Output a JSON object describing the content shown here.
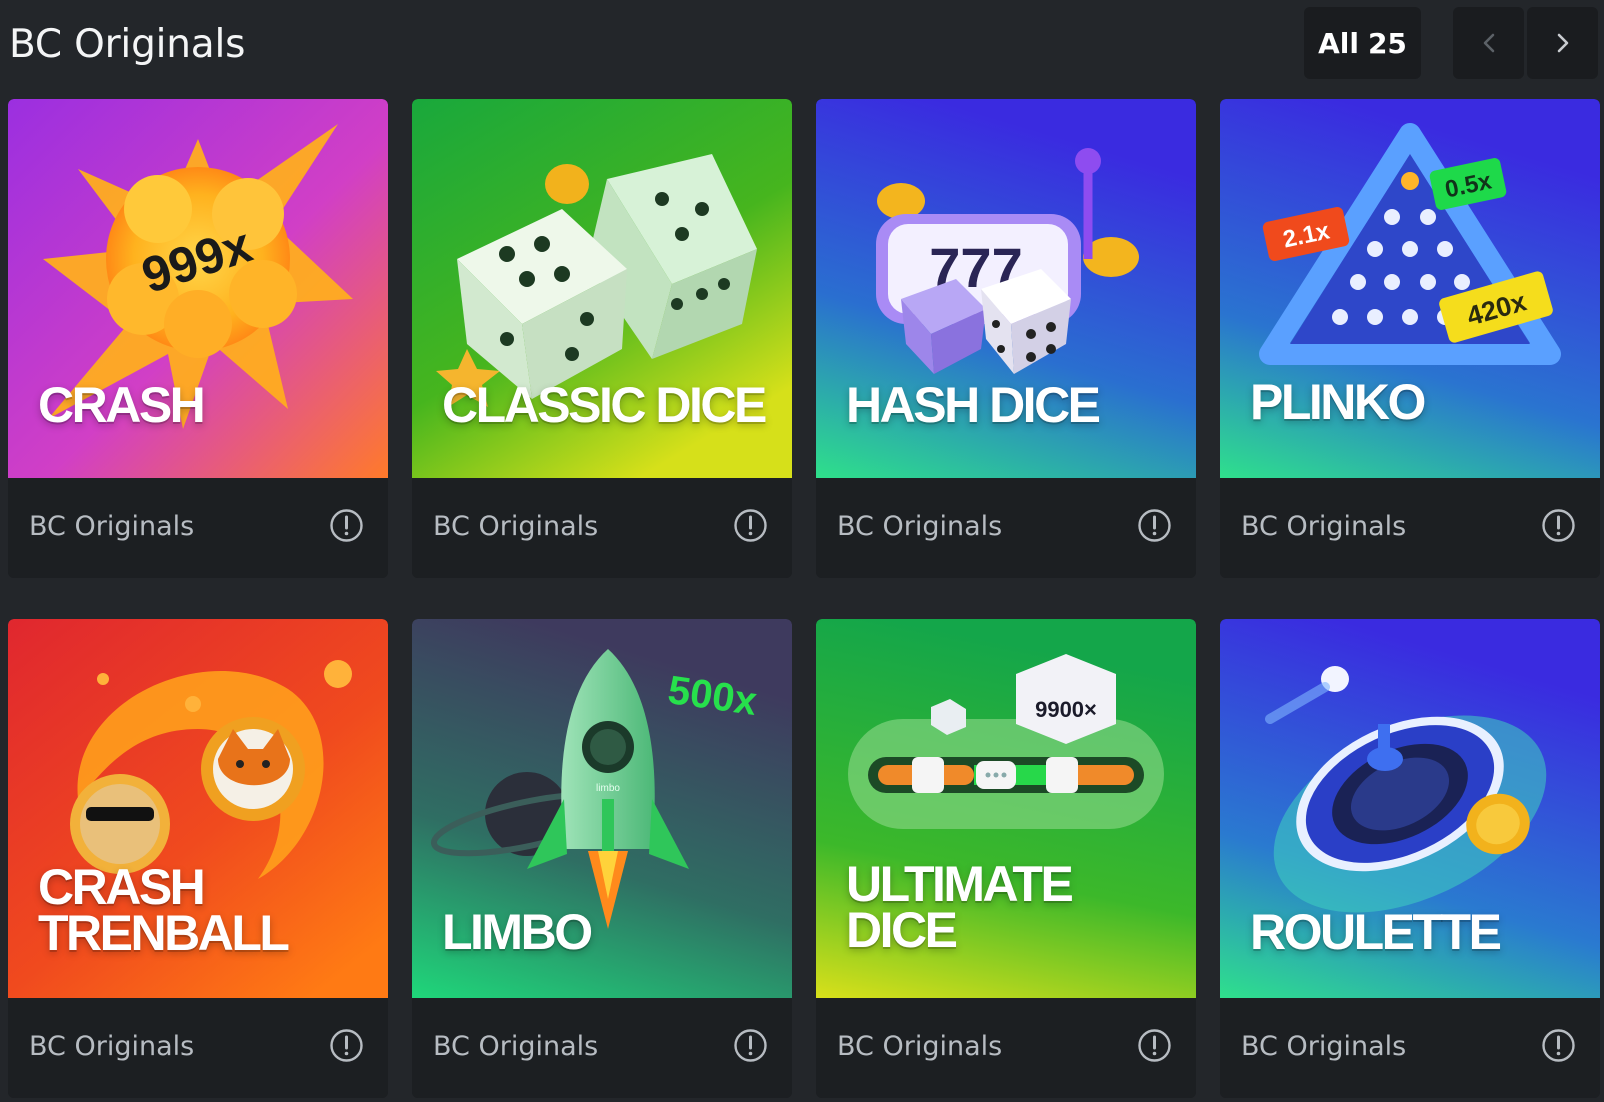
{
  "section": {
    "title": "BC Originals",
    "all_label": "All",
    "all_count": "25"
  },
  "colors": {
    "background": "#23262a",
    "card": "#1c1f22",
    "button": "#1a1c1f",
    "provider_text": "#b7bcc2"
  },
  "games": [
    {
      "title": "CRASH",
      "provider": "BC Originals",
      "art_text": "999x"
    },
    {
      "title": "CLASSIC DICE",
      "provider": "BC Originals"
    },
    {
      "title": "HASH DICE",
      "provider": "BC Originals",
      "art_text": "777"
    },
    {
      "title": "PLINKO",
      "provider": "BC Originals",
      "multipliers": [
        "2.1x",
        "0.5x",
        "420x"
      ]
    },
    {
      "title": "CRASH\nTRENBALL",
      "provider": "BC Originals"
    },
    {
      "title": "LIMBO",
      "provider": "BC Originals",
      "art_text": "500x",
      "rocket_label": "limbo"
    },
    {
      "title": "ULTIMATE\nDICE",
      "provider": "BC Originals",
      "art_text": "9900×"
    },
    {
      "title": "ROULETTE",
      "provider": "BC Originals"
    }
  ]
}
